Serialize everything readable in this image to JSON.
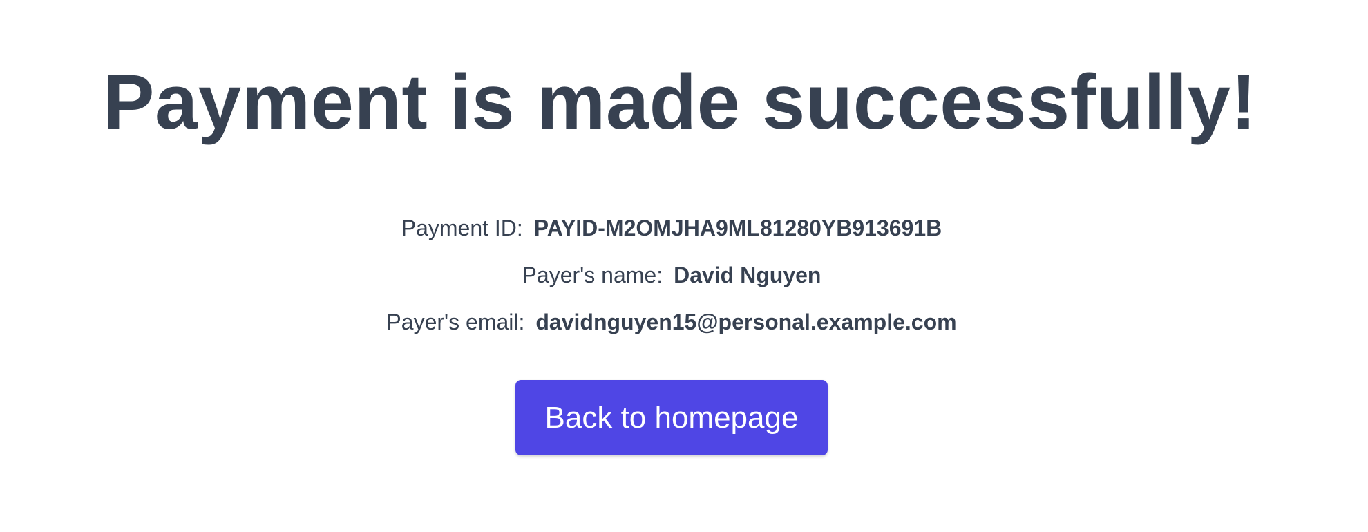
{
  "title": "Payment is made successfully!",
  "details": [
    {
      "label": "Payment ID:",
      "value": "PAYID-M2OMJHA9ML81280YB913691B"
    },
    {
      "label": "Payer's name:",
      "value": "David Nguyen"
    },
    {
      "label": "Payer's email:",
      "value": "davidnguyen15@personal.example.com"
    }
  ],
  "back_button": {
    "label": "Back to homepage"
  },
  "colors": {
    "text": "#374151",
    "button_bg": "#4f46e5",
    "button_text": "#ffffff"
  }
}
